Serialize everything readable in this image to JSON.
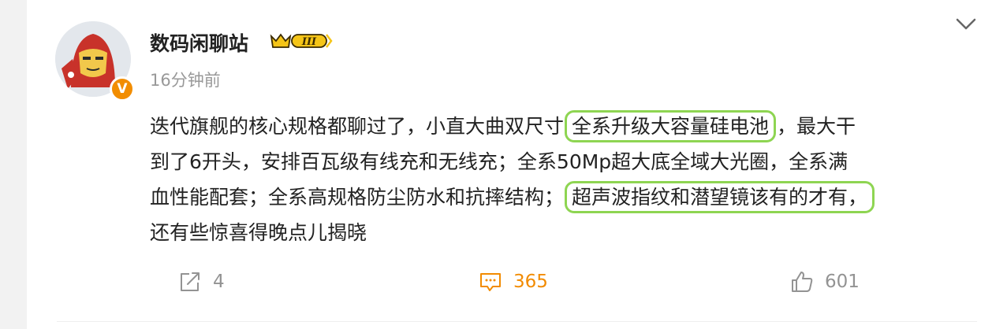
{
  "post": {
    "author": {
      "name": "数码闲聊站",
      "verified_badge": "V"
    },
    "timestamp": "16分钟前",
    "body": {
      "line1": [
        "迭代旗舰的核心规格都聊过了，小直大曲双尺寸",
        "全系升级大容量硅电池",
        "，最大干"
      ],
      "line2": "到了6开头，安排百瓦级有线充和无线充；全系50Mp超大底全域大光圈，全系满",
      "line3": [
        "血性能配套；全系高规格防尘防水和抗摔结构；",
        "超声波指纹和潜望镜该有的才有，"
      ],
      "line4": "还有些惊喜得晚点儿揭晓"
    },
    "actions": {
      "repost_count": "4",
      "comment_count": "365",
      "like_count": "601"
    }
  },
  "colors": {
    "highlight_outline": "#8ed552",
    "comment_accent": "#f28b00",
    "verified_badge": "#f28d00"
  },
  "icons": [
    "avatar-iron-man",
    "vip-level-badge-icon",
    "chevron-down-icon",
    "repost-icon",
    "comment-icon",
    "like-icon"
  ]
}
